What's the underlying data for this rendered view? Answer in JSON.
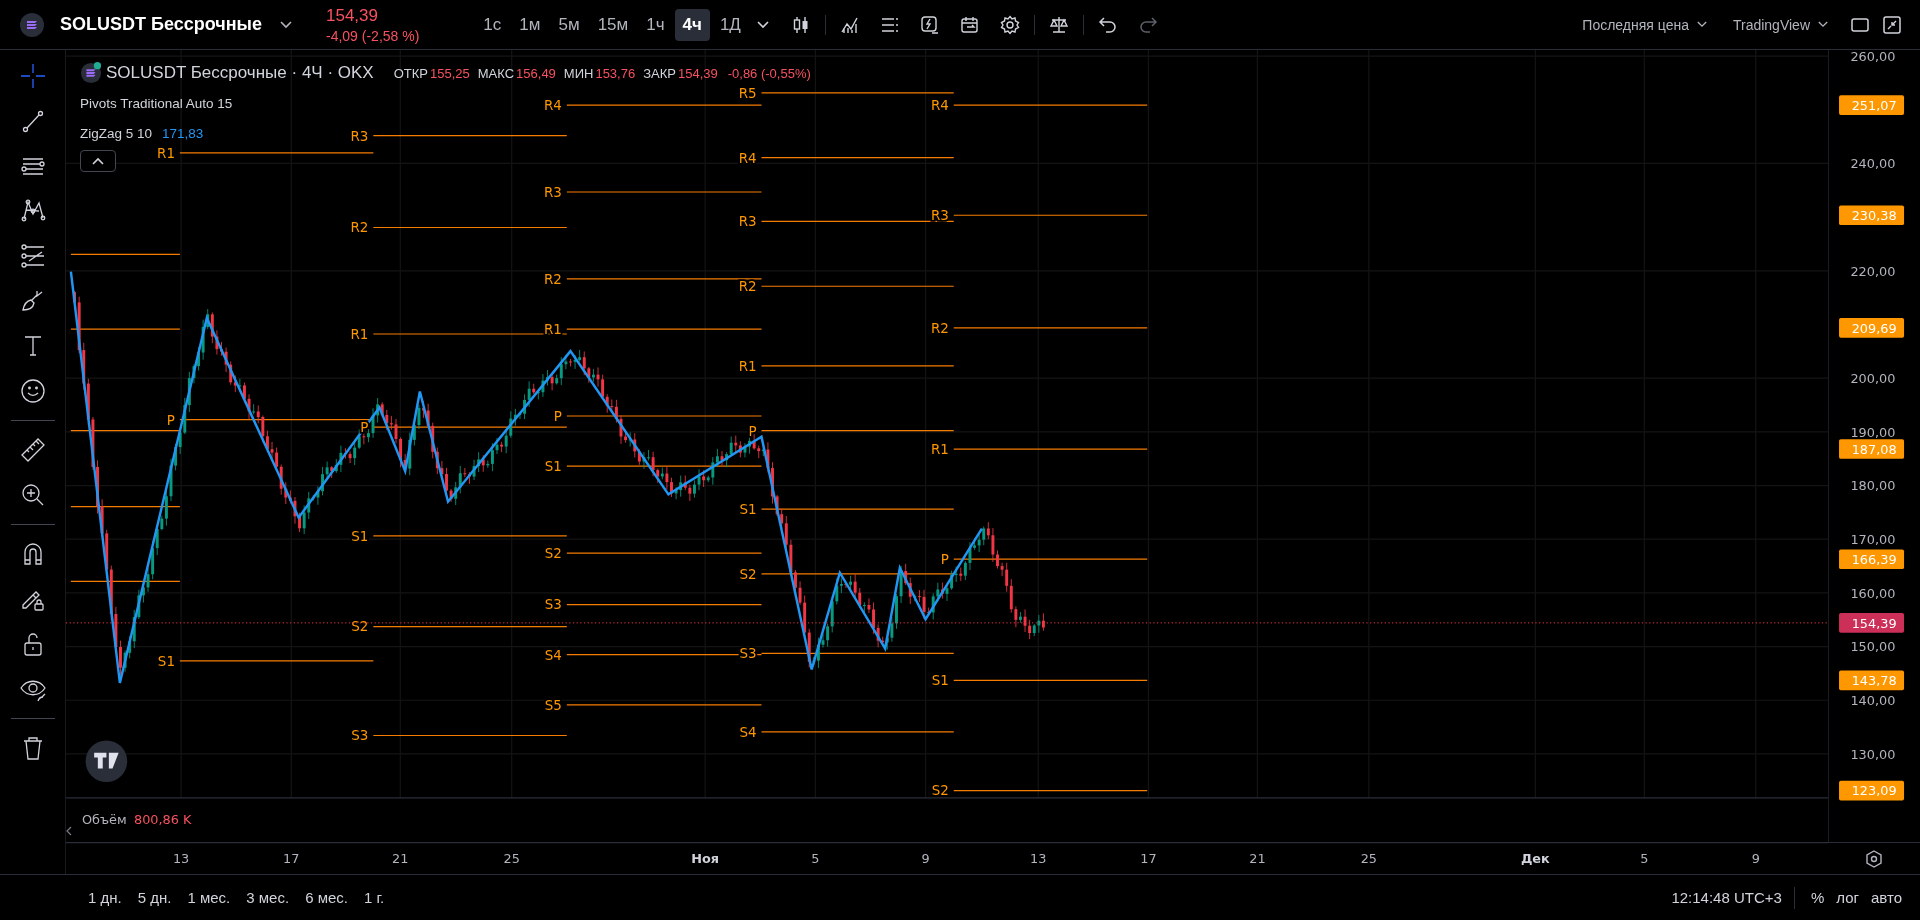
{
  "top_bar": {
    "symbol": "SOLUSDT Бессрочные",
    "price": "154,39",
    "change": "-4,09 (-2,58 %)",
    "intervals": [
      {
        "label": "1с",
        "selected": false
      },
      {
        "label": "1м",
        "selected": false
      },
      {
        "label": "5м",
        "selected": false
      },
      {
        "label": "15м",
        "selected": false
      },
      {
        "label": "1ч",
        "selected": false
      },
      {
        "label": "4ч",
        "selected": true
      },
      {
        "label": "1Д",
        "selected": false
      }
    ],
    "history": [
      {
        "kind": "undo",
        "disabled": false
      },
      {
        "kind": "redo",
        "disabled": true
      }
    ],
    "price_source": "Последняя цена",
    "layout_name": "TradingView"
  },
  "left_toolbar": {
    "tool_groups": [
      [
        {
          "kind": "crosshair",
          "selected": true
        },
        {
          "kind": "trendline",
          "selected": false
        },
        {
          "kind": "fib",
          "selected": false
        },
        {
          "kind": "pattern",
          "selected": false
        },
        {
          "kind": "forecast",
          "selected": false
        },
        {
          "kind": "brush",
          "selected": false
        },
        {
          "kind": "text",
          "selected": false
        },
        {
          "kind": "emoji",
          "selected": false
        }
      ],
      [
        {
          "kind": "ruler",
          "selected": false
        },
        {
          "kind": "zoom",
          "selected": false
        }
      ],
      [
        {
          "kind": "magnet",
          "selected": false
        },
        {
          "kind": "pencil_lock",
          "selected": false
        },
        {
          "kind": "lock",
          "selected": false
        },
        {
          "kind": "eye",
          "selected": false
        }
      ],
      [
        {
          "kind": "trash",
          "selected": false
        }
      ]
    ]
  },
  "legend": {
    "title": "SOLUSDT Бессрочные · 4Ч · OKX",
    "ohlc": [
      {
        "label": "ОТКР",
        "value": "155,25"
      },
      {
        "label": "МАКС",
        "value": "156,49"
      },
      {
        "label": "МИН",
        "value": "153,76"
      },
      {
        "label": "ЗАКР",
        "value": "154,39"
      }
    ],
    "change": "-0,86 (-0,55%)",
    "indicators": [
      {
        "name": "Pivots Traditional Auto 15"
      },
      {
        "name": "ZigZag 5 10",
        "value": "171,83"
      }
    ]
  },
  "pivots": [
    {
      "levels": [
        "R1",
        "P",
        "S1"
      ]
    },
    {
      "levels": [
        "R3",
        "R2",
        "R1",
        "P",
        "S1",
        "S2",
        "S3"
      ]
    },
    {
      "levels": [
        "R4",
        "R3",
        "R2",
        "R1",
        "P",
        "S1",
        "S2",
        "S3",
        "S4",
        "S5"
      ]
    },
    {
      "levels": [
        "R5",
        "R4",
        "R3",
        "R2",
        "R1",
        "P",
        "S1",
        "S2",
        "S3",
        "S4"
      ]
    },
    {
      "levels": [
        "R4",
        "R3",
        "R2",
        "R1",
        "P",
        "S1",
        "S2"
      ]
    }
  ],
  "volume": {
    "label": "Объём",
    "value": "800,86 K"
  },
  "price_axis": {
    "ticks": [
      "260,00",
      "240,00",
      "220,00",
      "200,00",
      "190,00",
      "180,00",
      "170,00",
      "160,00",
      "150,00",
      "140,00",
      "130,00"
    ],
    "badges": [
      {
        "text": "251,07",
        "kind": "pivot"
      },
      {
        "text": "230,38",
        "kind": "pivot"
      },
      {
        "text": "209,69",
        "kind": "pivot"
      },
      {
        "text": "187,08",
        "kind": "pivot"
      },
      {
        "text": "166,39",
        "kind": "pivot"
      },
      {
        "text": "154,39",
        "kind": "last"
      },
      {
        "text": "143,78",
        "kind": "pivot"
      },
      {
        "text": "123,09",
        "kind": "pivot"
      }
    ]
  },
  "time_axis": {
    "ticks": [
      {
        "label": "13",
        "kind": "day"
      },
      {
        "label": "17",
        "kind": "day"
      },
      {
        "label": "21",
        "kind": "day"
      },
      {
        "label": "25",
        "kind": "day"
      },
      {
        "label": "Ноя",
        "kind": "month"
      },
      {
        "label": "5",
        "kind": "day"
      },
      {
        "label": "9",
        "kind": "day"
      },
      {
        "label": "13",
        "kind": "day"
      },
      {
        "label": "17",
        "kind": "day"
      },
      {
        "label": "21",
        "kind": "day"
      },
      {
        "label": "25",
        "kind": "day"
      },
      {
        "label": "Дек",
        "kind": "month"
      },
      {
        "label": "5",
        "kind": "day"
      },
      {
        "label": "9",
        "kind": "day"
      }
    ]
  },
  "bottom_bar": {
    "ranges": [
      "1 дн.",
      "5 дн.",
      "1 мес.",
      "3 мес.",
      "6 мес.",
      "1 г."
    ],
    "clock": "12:14:48 UTC+3",
    "scale_buttons": [
      "%",
      "лог",
      "авто"
    ]
  }
}
